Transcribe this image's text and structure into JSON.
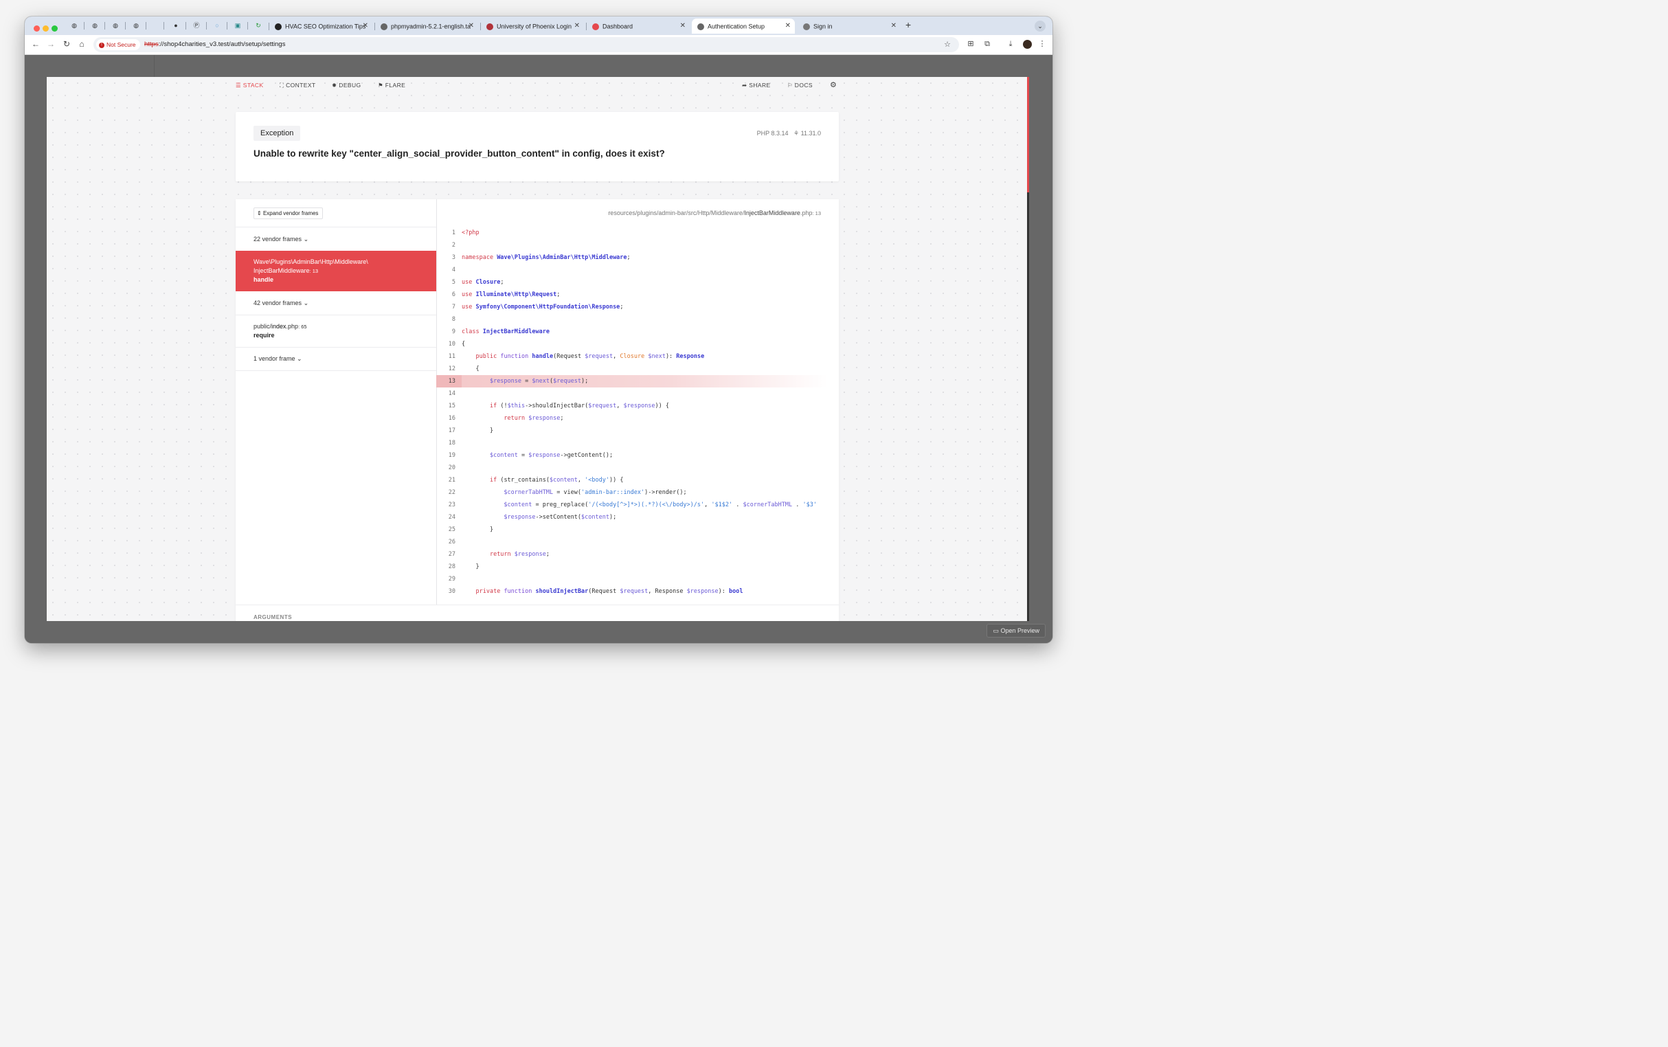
{
  "browser": {
    "tabs": [
      {
        "label": "HVAC SEO Optimization Tips"
      },
      {
        "label": "phpmyadmin-5.2.1-english.ta"
      },
      {
        "label": "University of Phoenix Login"
      },
      {
        "label": "Dashboard"
      },
      {
        "label": "Authentication Setup"
      },
      {
        "label": "Sign in"
      }
    ],
    "security_label": "Not Secure",
    "url_scheme": "https",
    "url_rest": "://shop4charities_v3.test/auth/setup/settings"
  },
  "ignition": {
    "nav": {
      "stack": "STACK",
      "context": "CONTEXT",
      "debug": "DEBUG",
      "flare": "FLARE",
      "share": "SHARE",
      "docs": "DOCS"
    },
    "exception": {
      "type": "Exception",
      "php_version": "PHP 8.3.14",
      "laravel_version": "11.31.0",
      "message": "Unable to rewrite key \"center_align_social_provider_button_content\" in config, does it exist?"
    },
    "frames": {
      "expand_label": "Expand vendor frames",
      "vendor_group_1": "22 vendor frames",
      "selected_path_1": "Wave\\Plugins\\AdminBar\\Http\\Middleware\\",
      "selected_path_2": "InjectBarMiddleware",
      "selected_line": ": 13",
      "selected_method": "handle",
      "vendor_group_2": "42 vendor frames",
      "frame_path_prefix": "public/",
      "frame_path_file": "index",
      "frame_path_ext": ".php",
      "frame_line": ": 65",
      "frame_method": "require",
      "vendor_group_3": "1 vendor frame"
    },
    "code": {
      "file_dir": "resources/plugins/admin-bar/src/Http/Middleware/",
      "file_name": "InjectBarMiddleware",
      "file_ext": ".php",
      "file_line": ": 13",
      "highlight_line": 13
    },
    "arguments_label": "ARGUMENTS",
    "open_preview": "Open Preview"
  },
  "colors": {
    "accent": "#e5484d",
    "highlight": "#f4c7c8"
  }
}
